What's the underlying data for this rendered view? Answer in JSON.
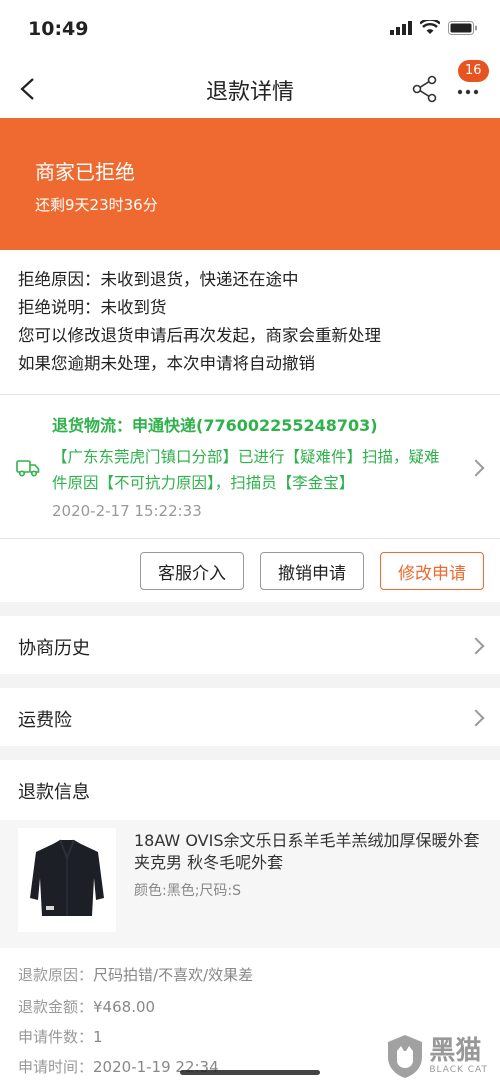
{
  "status_bar": {
    "time": "10:49"
  },
  "nav": {
    "title": "退款详情",
    "badge": "16"
  },
  "banner": {
    "title": "商家已拒绝",
    "subtitle": "还剩9天23时36分"
  },
  "rejection": {
    "lines": [
      "拒绝原因：未收到退货，快递还在途中",
      "拒绝说明：未收到货",
      "您可以修改退货申请后再次发起，商家会重新处理",
      "如果您逾期未处理，本次申请将自动撤销"
    ]
  },
  "logistics": {
    "title": "退货物流：申通快递(776002255248703)",
    "detail": "【广东东莞虎门镇口分部】已进行【疑难件】扫描，疑难件原因【不可抗力原因】，扫描员【李金宝】",
    "time": "2020-2-17  15:22:33"
  },
  "actions": {
    "service": "客服介入",
    "cancel": "撤销申请",
    "modify": "修改申请"
  },
  "sections": {
    "history": "协商历史",
    "insurance": "运费险"
  },
  "refund": {
    "header": "退款信息",
    "product_name": "18AW OVIS余文乐日系羊毛羊羔绒加厚保暖外套夹克男 秋冬毛呢外套",
    "product_spec": "颜色:黑色;尺码:S",
    "reason_label": "退款原因：",
    "reason_value": "尺码拍错/不喜欢/效果差",
    "amount_label": "退款金额：",
    "amount_value": "¥468.00",
    "count_label": "申请件数：",
    "count_value": "1",
    "time_label": "申请时间：",
    "time_value": "2020-1-19 22:34"
  },
  "watermark": {
    "text": "黑猫",
    "sub": "BLACK CAT"
  },
  "colors": {
    "accent": "#ee6a30",
    "logistics_green": "#2fb24b"
  }
}
